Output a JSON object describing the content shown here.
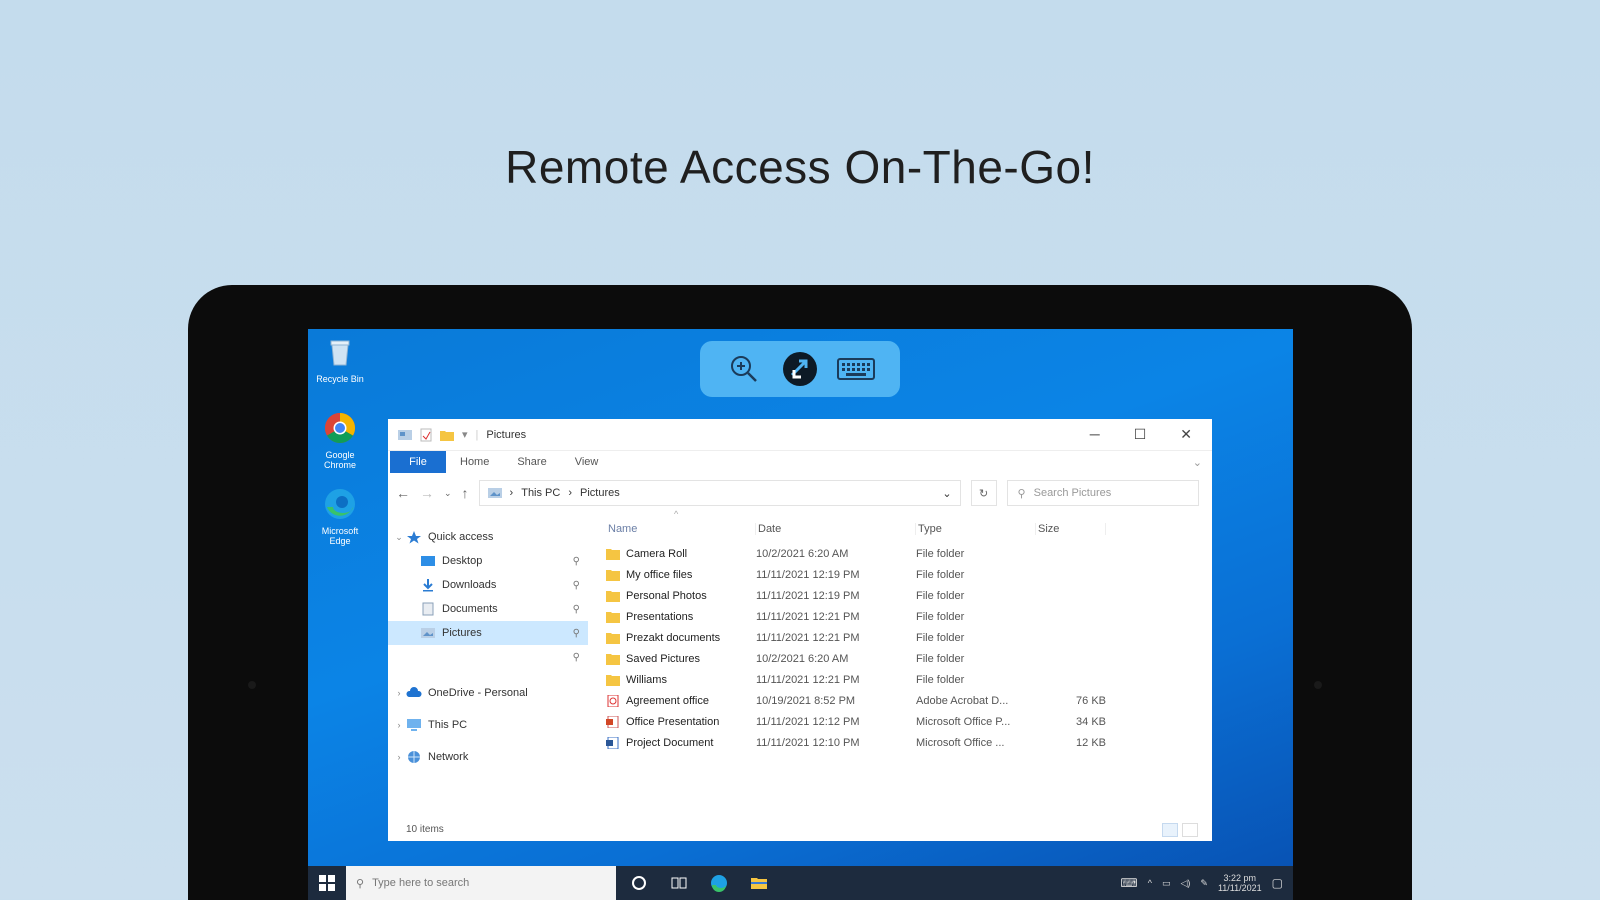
{
  "headline": "Remote Access On-The-Go!",
  "desktop_icons": [
    {
      "label": "Recycle Bin",
      "icon": "recycle-bin-icon"
    },
    {
      "label": "Google Chrome",
      "icon": "chrome-icon"
    },
    {
      "label": "Microsoft Edge",
      "icon": "edge-icon"
    }
  ],
  "remote_toolbar": {
    "buttons": [
      {
        "icon": "zoom-in-icon"
      },
      {
        "icon": "remote-connection-icon"
      },
      {
        "icon": "keyboard-icon"
      }
    ]
  },
  "explorer": {
    "title": "Pictures",
    "ribbon_tabs": [
      "File",
      "Home",
      "Share",
      "View"
    ],
    "breadcrumb": [
      "This PC",
      "Pictures"
    ],
    "search_placeholder": "Search Pictures",
    "nav": [
      {
        "label": "Quick access",
        "icon": "star-icon",
        "level": 0,
        "expanded": true
      },
      {
        "label": "Desktop",
        "icon": "desktop-folder-icon",
        "level": 1,
        "pinned": true
      },
      {
        "label": "Downloads",
        "icon": "download-folder-icon",
        "level": 1,
        "pinned": true
      },
      {
        "label": "Documents",
        "icon": "documents-folder-icon",
        "level": 1,
        "pinned": true
      },
      {
        "label": "Pictures",
        "icon": "pictures-folder-icon",
        "level": 1,
        "pinned": true,
        "selected": true
      },
      {
        "label": "",
        "icon": "",
        "level": 1,
        "pinned": true
      },
      {
        "label": "OneDrive - Personal",
        "icon": "cloud-icon",
        "level": 0
      },
      {
        "label": "This PC",
        "icon": "computer-icon",
        "level": 0
      },
      {
        "label": "Network",
        "icon": "network-icon",
        "level": 0
      }
    ],
    "columns": [
      "Name",
      "Date",
      "Type",
      "Size"
    ],
    "files": [
      {
        "name": "Camera Roll",
        "date": "10/2/2021 6:20 AM",
        "type": "File folder",
        "size": "",
        "icon": "folder-icon"
      },
      {
        "name": "My office files",
        "date": "11/11/2021 12:19 PM",
        "type": "File folder",
        "size": "",
        "icon": "folder-icon"
      },
      {
        "name": "Personal Photos",
        "date": "11/11/2021 12:19 PM",
        "type": "File folder",
        "size": "",
        "icon": "folder-icon"
      },
      {
        "name": "Presentations",
        "date": "11/11/2021 12:21 PM",
        "type": "File folder",
        "size": "",
        "icon": "folder-icon"
      },
      {
        "name": "Prezakt documents",
        "date": "11/11/2021 12:21 PM",
        "type": "File folder",
        "size": "",
        "icon": "folder-icon"
      },
      {
        "name": "Saved Pictures",
        "date": "10/2/2021 6:20 AM",
        "type": "File folder",
        "size": "",
        "icon": "folder-icon"
      },
      {
        "name": "Williams",
        "date": "11/11/2021 12:21 PM",
        "type": "File folder",
        "size": "",
        "icon": "folder-icon"
      },
      {
        "name": "Agreement office",
        "date": "10/19/2021 8:52 PM",
        "type": "Adobe Acrobat D...",
        "size": "76 KB",
        "icon": "pdf-icon"
      },
      {
        "name": "Office Presentation",
        "date": "11/11/2021 12:12 PM",
        "type": "Microsoft Office P...",
        "size": "34 KB",
        "icon": "powerpoint-icon"
      },
      {
        "name": "Project Document",
        "date": "11/11/2021 12:10 PM",
        "type": "Microsoft Office ...",
        "size": "12 KB",
        "icon": "word-icon"
      }
    ],
    "status": "10 items"
  },
  "taskbar": {
    "search_placeholder": "Type here to search",
    "clock_time": "3:22 pm",
    "clock_date": "11/11/2021"
  },
  "colors": {
    "background": "#c4dced",
    "desktop": "#0a7ad8",
    "toolbar": "#4fb4f3",
    "ribbon_file": "#1a6fd1",
    "selection": "#cce8ff",
    "taskbar": "#1d2b3e"
  }
}
